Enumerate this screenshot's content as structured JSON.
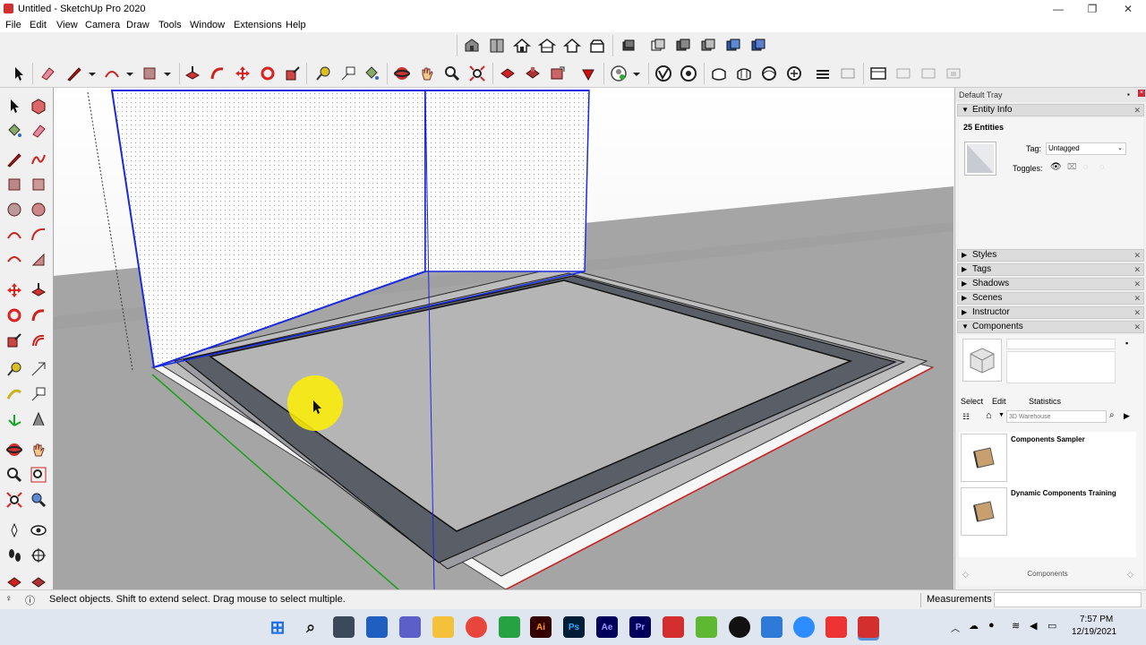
{
  "window": {
    "title": "Untitled - SketchUp Pro 2020",
    "minimize": "—",
    "maximize": "❐",
    "close": "✕"
  },
  "menu": [
    "File",
    "Edit",
    "View",
    "Camera",
    "Draw",
    "Tools",
    "Window",
    "Extensions",
    "Help"
  ],
  "tray": {
    "title": "Default Tray",
    "entity_info": {
      "header": "Entity Info",
      "count": "25 Entities",
      "tag_label": "Tag:",
      "tag_value": "Untagged",
      "toggles_label": "Toggles:"
    },
    "panels": [
      "Styles",
      "Tags",
      "Shadows",
      "Scenes",
      "Instructor"
    ],
    "components": {
      "header": "Components",
      "tabs": [
        "Select",
        "Edit",
        "Statistics"
      ],
      "search_placeholder": "3D Warehouse",
      "items": [
        "Components Sampler",
        "Dynamic Components Training"
      ],
      "footer": "Components"
    }
  },
  "status": {
    "message": "Select objects. Shift to extend select. Drag mouse to select multiple.",
    "measurements_label": "Measurements"
  },
  "taskbar": {
    "time": "7:57 PM",
    "date": "12/19/2021",
    "apps": [
      "Ai",
      "Ps",
      "Ae",
      "Pr"
    ]
  },
  "colors": {
    "accent_blue": "#1a2adf",
    "selection_yellow": "#fff000",
    "sky_top": "#ffffff",
    "ground": "#a8a8a8"
  }
}
